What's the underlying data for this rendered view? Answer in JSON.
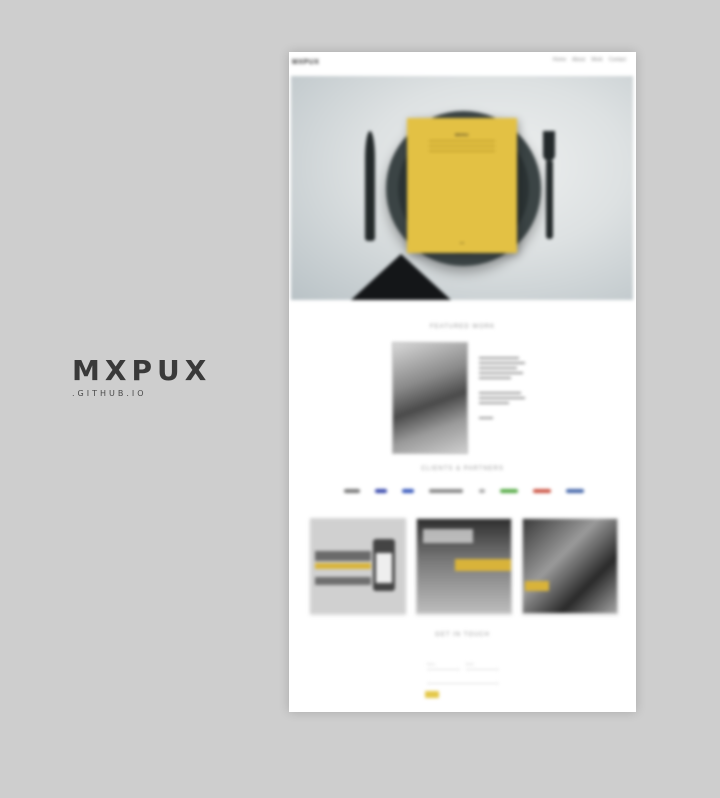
{
  "brand": {
    "logo_text": "MXPUX",
    "sub_text": ".GITHUB.IO"
  },
  "preview": {
    "site_logo": "MXPUX",
    "nav_items": [
      "Home",
      "About",
      "Work",
      "Contact"
    ],
    "hero": {
      "menu_title": "MENU",
      "menu_footer": "•••"
    },
    "section_featured": "FEATURED WORK",
    "section_clients": "CLIENTS & PARTNERS",
    "section_contact": "GET IN TOUCH",
    "client_logos": [
      {
        "name": "logo-1",
        "color": "#777777"
      },
      {
        "name": "logo-2",
        "color": "#3344aa"
      },
      {
        "name": "logo-3",
        "color": "#3355bb"
      },
      {
        "name": "logo-4",
        "color": "#666666"
      },
      {
        "name": "logo-5",
        "color": "#aaaaaa"
      },
      {
        "name": "logo-6",
        "color": "#55aa44"
      },
      {
        "name": "logo-7",
        "color": "#cc5544"
      },
      {
        "name": "logo-8",
        "color": "#4466aa"
      }
    ],
    "form": {
      "name_placeholder": "Name",
      "email_placeholder": "Email",
      "submit_label": ""
    }
  },
  "colors": {
    "background": "#cecece",
    "accent": "#e3c144"
  }
}
